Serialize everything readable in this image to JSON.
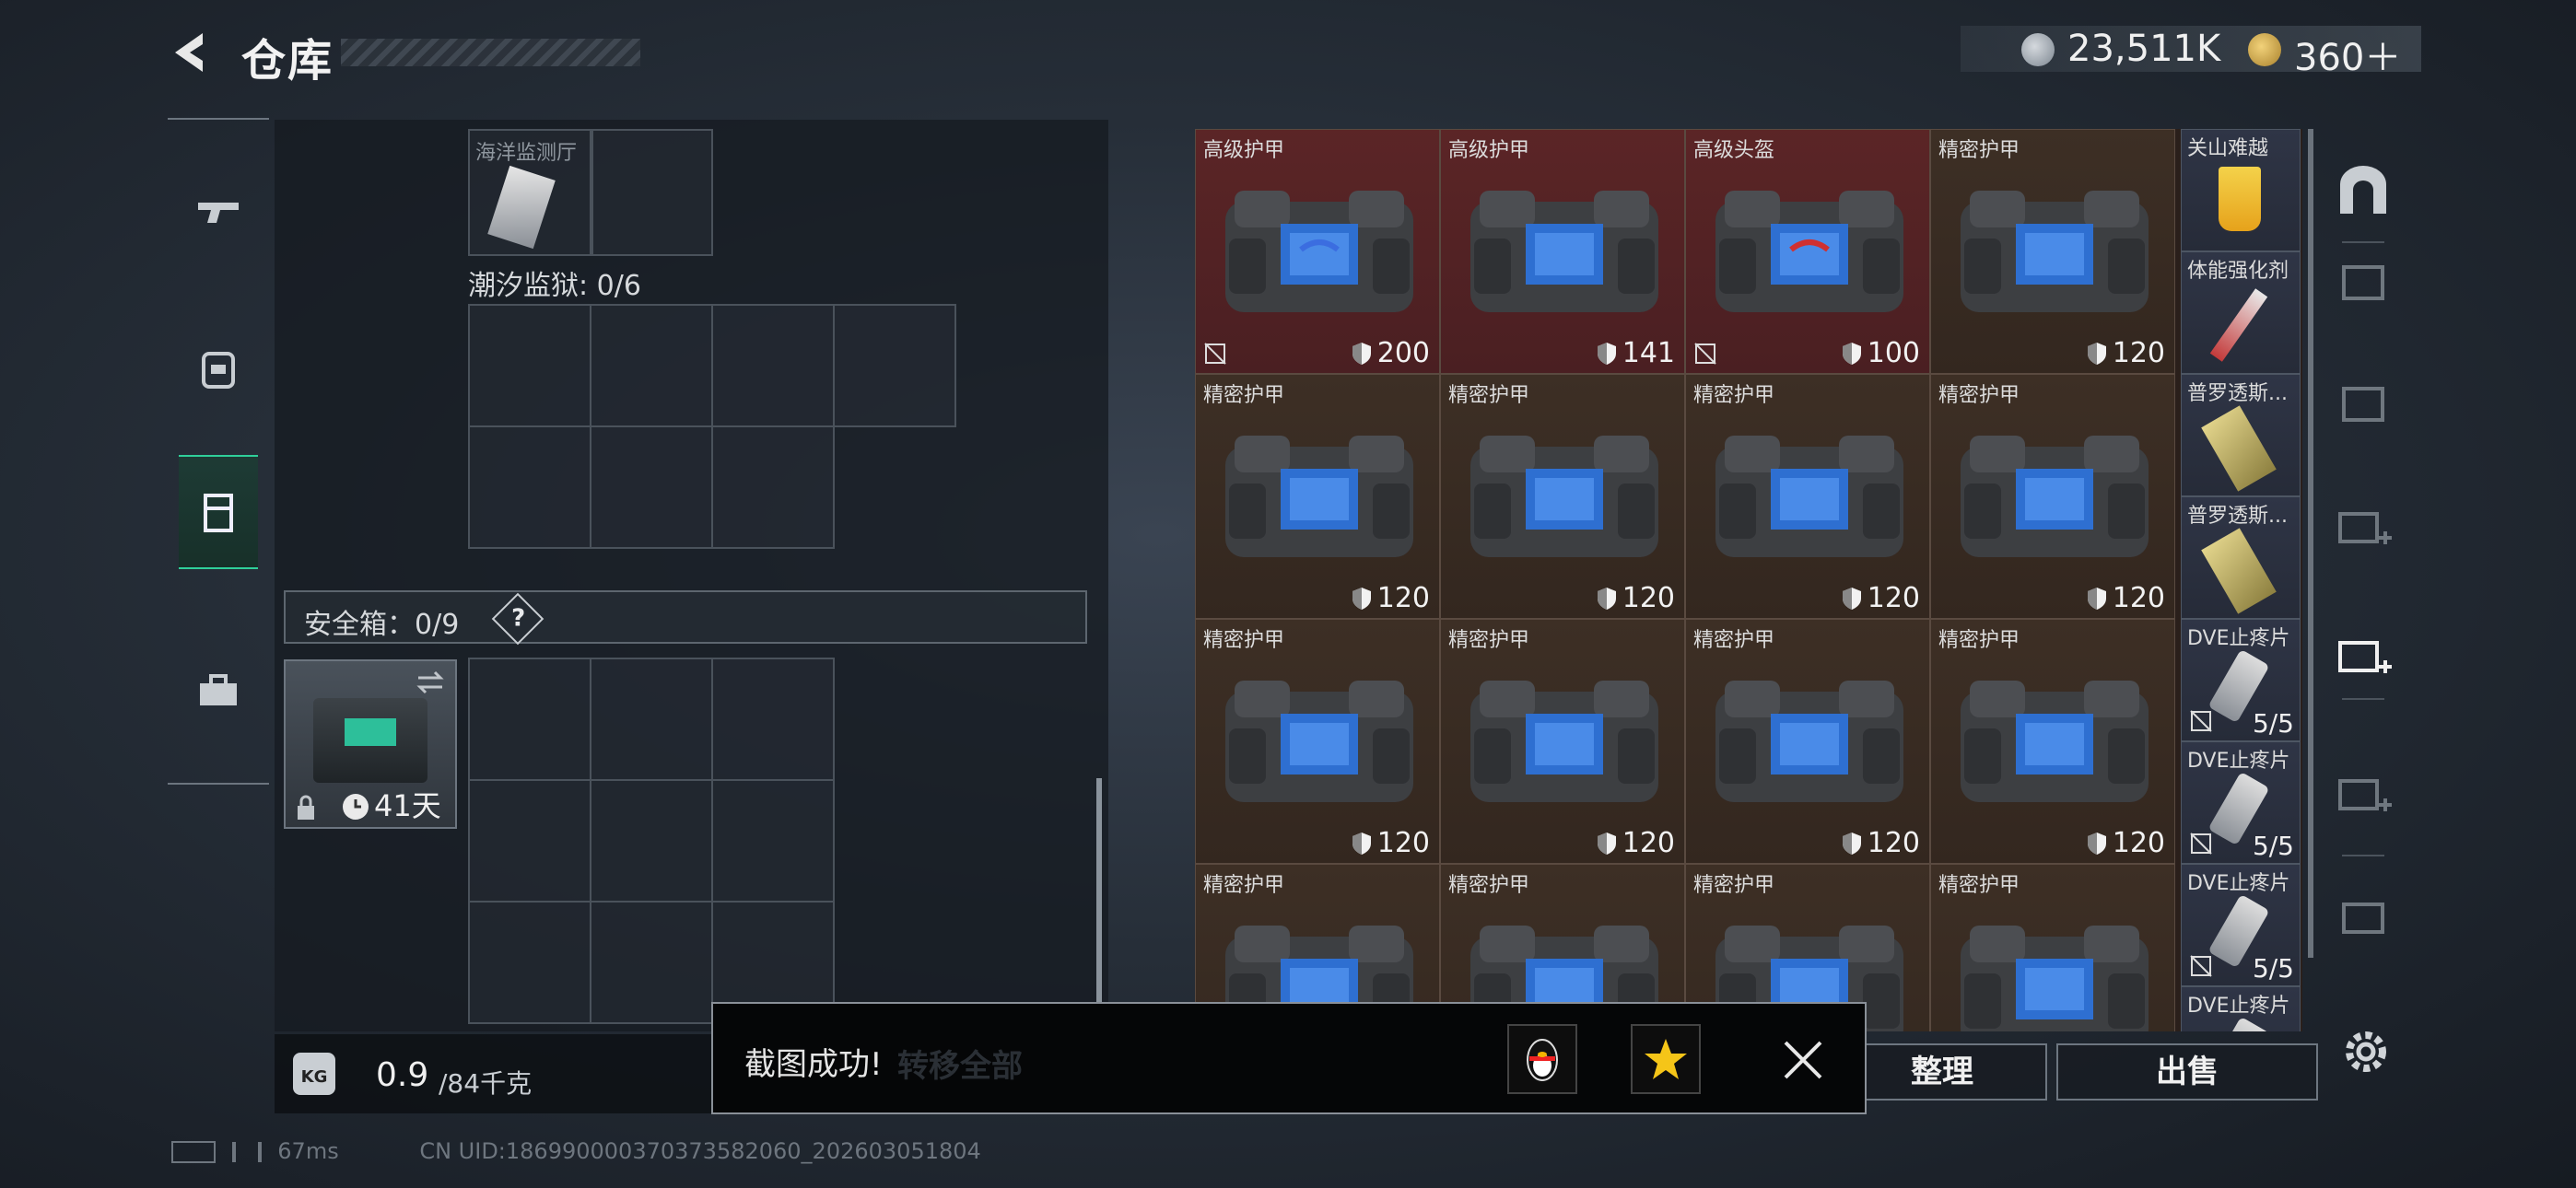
{
  "header": {
    "title": "仓库"
  },
  "currency": {
    "silver": "23,511K",
    "gold": "360＋"
  },
  "left": {
    "slot_label": "海洋监测厅",
    "section_label": "潮汐监狱: 0/6",
    "safe_box_label": "安全箱：0/9",
    "safe_box_help": "?",
    "safe_box_days": "41天"
  },
  "weight": {
    "current": "0.9",
    "max": "/84千克",
    "icon": "KG"
  },
  "items": [
    {
      "name": "高级护甲",
      "dur": "200",
      "color": "red",
      "nosell": true
    },
    {
      "name": "高级护甲",
      "dur": "141",
      "color": "red",
      "nosell": false
    },
    {
      "name": "高级头盔",
      "dur": "100",
      "color": "red",
      "nosell": true
    },
    {
      "name": "精密护甲",
      "dur": "120",
      "color": "brown",
      "nosell": false
    },
    {
      "name": "精密护甲",
      "dur": "120",
      "color": "brown",
      "nosell": false
    },
    {
      "name": "精密护甲",
      "dur": "120",
      "color": "brown",
      "nosell": false
    },
    {
      "name": "精密护甲",
      "dur": "120",
      "color": "brown",
      "nosell": false
    },
    {
      "name": "精密护甲",
      "dur": "120",
      "color": "brown",
      "nosell": false
    },
    {
      "name": "精密护甲",
      "dur": "120",
      "color": "brown",
      "nosell": false
    },
    {
      "name": "精密护甲",
      "dur": "120",
      "color": "brown",
      "nosell": false
    },
    {
      "name": "精密护甲",
      "dur": "120",
      "color": "brown",
      "nosell": false
    },
    {
      "name": "精密护甲",
      "dur": "120",
      "color": "brown",
      "nosell": false
    },
    {
      "name": "精密护甲",
      "dur": "",
      "color": "brown",
      "nosell": false
    },
    {
      "name": "精密护甲",
      "dur": "",
      "color": "brown",
      "nosell": false
    },
    {
      "name": "精密护甲",
      "dur": "",
      "color": "brown",
      "nosell": false
    },
    {
      "name": "精密护甲",
      "dur": "",
      "color": "brown",
      "nosell": false
    }
  ],
  "side_items": [
    {
      "name": "关山难越",
      "count": ""
    },
    {
      "name": "体能强化剂",
      "count": ""
    },
    {
      "name": "普罗透斯...",
      "count": ""
    },
    {
      "name": "普罗透斯...",
      "count": ""
    },
    {
      "name": "DVE止疼片",
      "count": "5/5"
    },
    {
      "name": "DVE止疼片",
      "count": "5/5"
    },
    {
      "name": "DVE止疼片",
      "count": "5/5"
    },
    {
      "name": "DVE止疼片",
      "count": ""
    }
  ],
  "buttons": {
    "sort": "整理",
    "sell": "出售",
    "transfer_all": "转移全部"
  },
  "toast": {
    "message": "截图成功!"
  },
  "status": {
    "ping": "67ms",
    "uid": "CN UID:18699000037037358206​0_202603051804"
  },
  "colors": {
    "accent": "#2fcf9a",
    "red_cell": "#5b2526",
    "brown_cell": "#3d2f25"
  }
}
